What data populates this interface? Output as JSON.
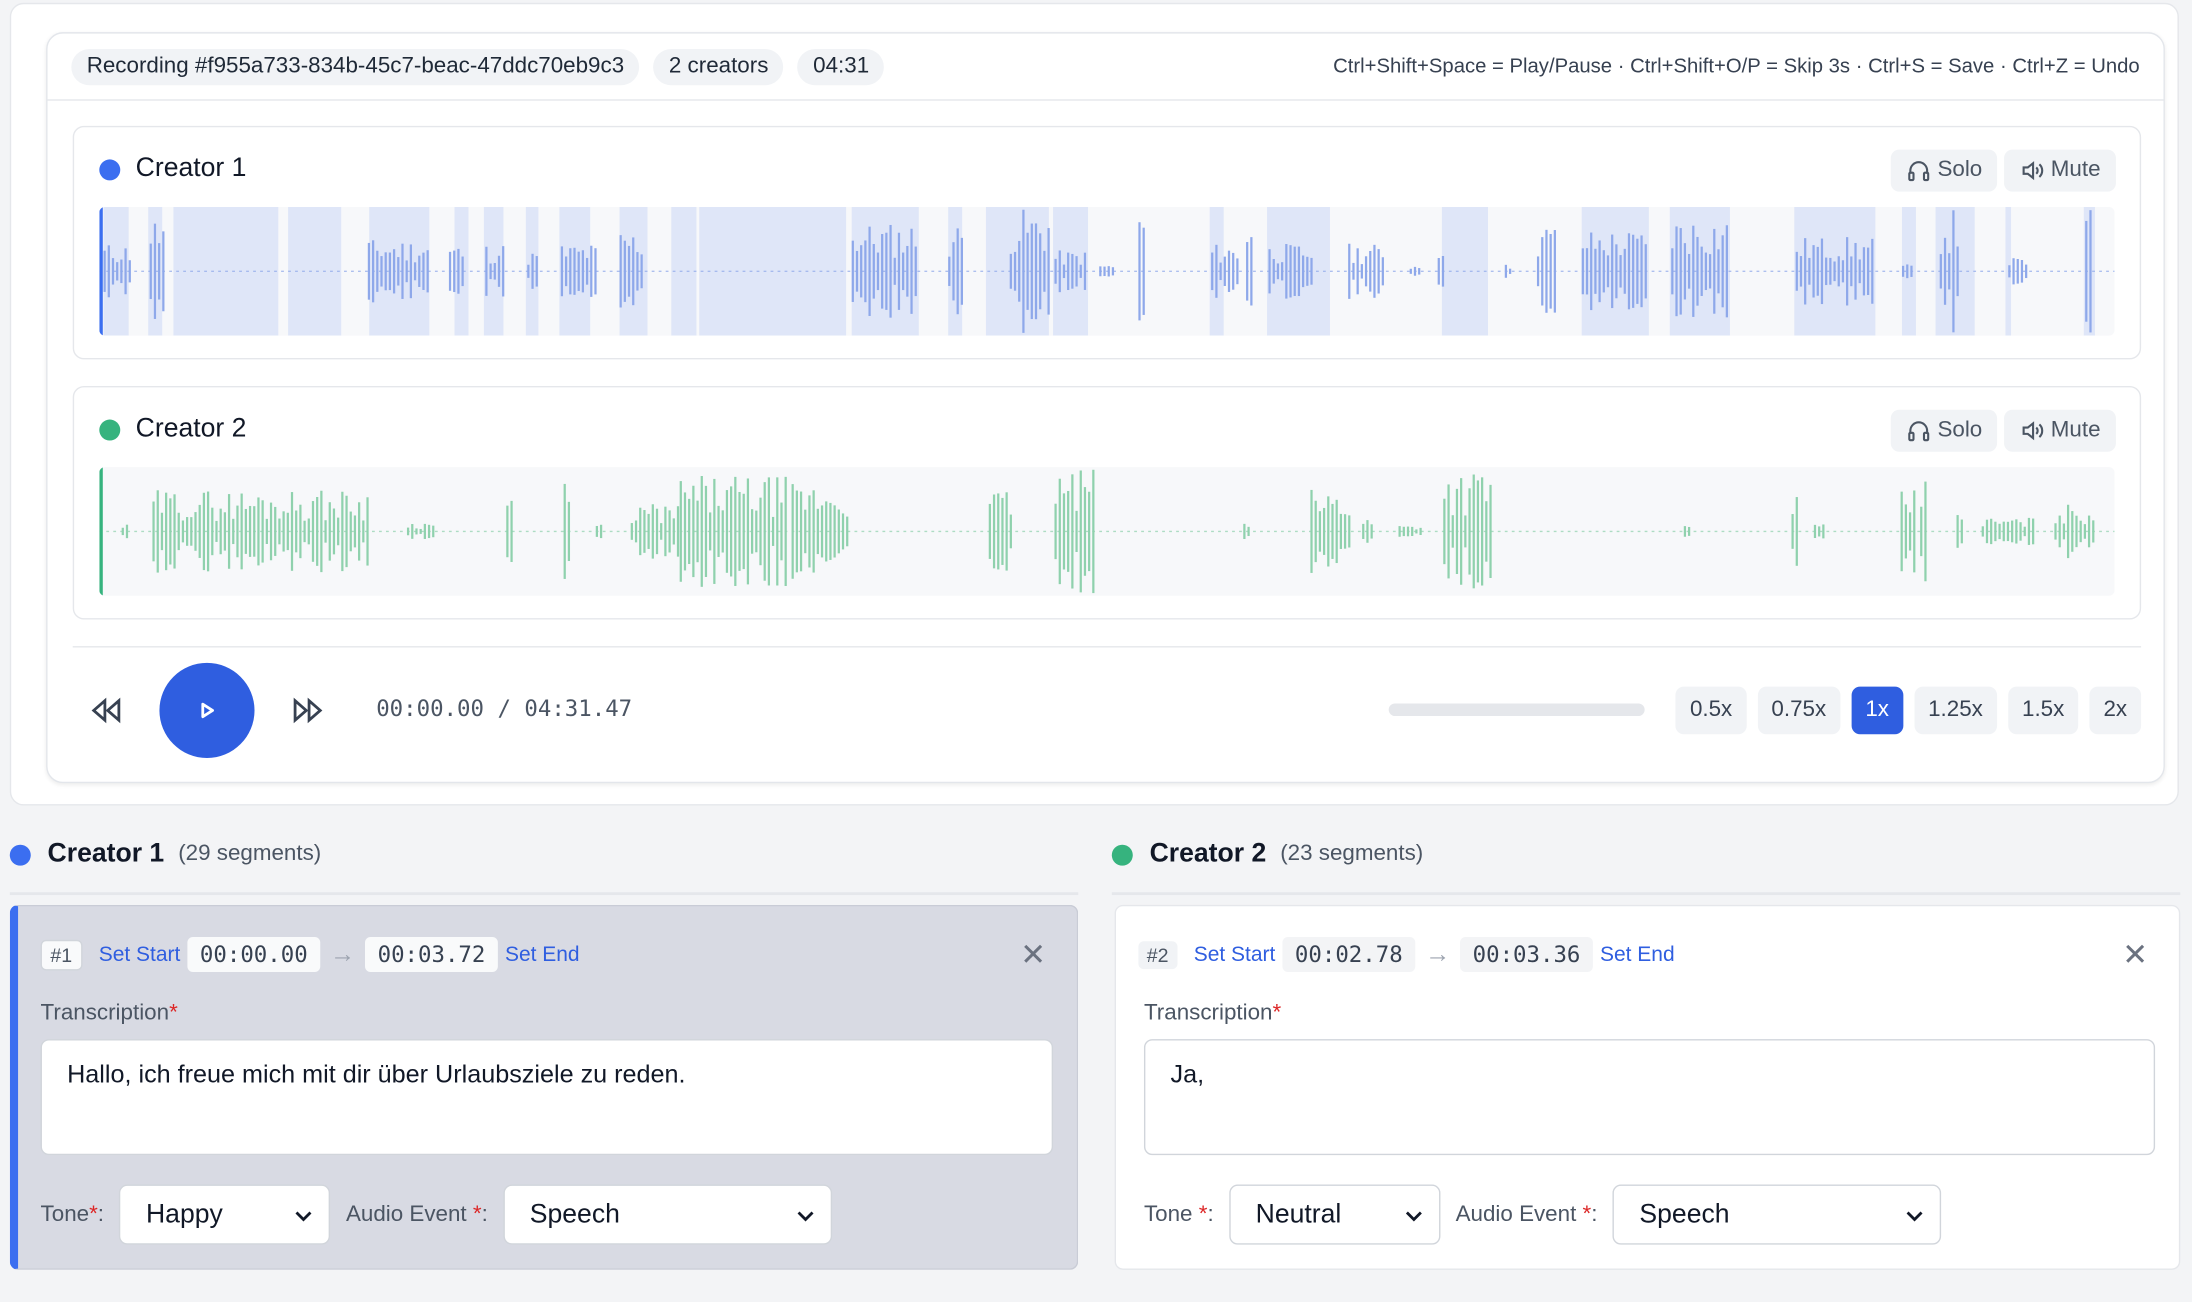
{
  "header": {
    "recording": "Recording #f955a733-834b-45c7-beac-47ddc70eb9c3",
    "creators": "2 creators",
    "duration": "04:31",
    "shortcuts": "Ctrl+Shift+Space = Play/Pause · Ctrl+Shift+O/P = Skip 3s · Ctrl+S = Save · Ctrl+Z = Undo"
  },
  "tracks": [
    {
      "name": "Creator 1",
      "color": "#3b6ef0",
      "wave_color": "#8ea8ea",
      "solo": "Solo",
      "mute": "Mute"
    },
    {
      "name": "Creator 2",
      "color": "#36b37e",
      "wave_color": "#8fd1ad",
      "solo": "Solo",
      "mute": "Mute"
    }
  ],
  "player": {
    "time": "00:00.00 / 04:31.47",
    "speeds": [
      "0.5x",
      "0.75x",
      "1x",
      "1.25x",
      "1.5x",
      "2x"
    ],
    "active_speed": "1x"
  },
  "columns": [
    {
      "title": "Creator 1",
      "count": "(29 segments)",
      "color": "#3b6ef0"
    },
    {
      "title": "Creator 2",
      "count": "(23 segments)",
      "color": "#36b37e"
    }
  ],
  "segments": [
    {
      "num": "#1",
      "set_start": "Set Start",
      "start": "00:00.00",
      "end": "00:03.72",
      "set_end": "Set End",
      "transcription_label": "Transcription",
      "text": "Hallo, ich freue mich mit dir über Urlaubsziele zu reden.",
      "tone_label": "Tone",
      "tone": "Happy",
      "event_label": "Audio Event",
      "event": "Speech"
    },
    {
      "num": "#2",
      "set_start": "Set Start",
      "start": "00:02.78",
      "end": "00:03.36",
      "set_end": "Set End",
      "transcription_label": "Transcription",
      "text": "Ja,",
      "tone_label": "Tone",
      "tone": "Neutral",
      "event_label": "Audio Event",
      "event": "Speech"
    }
  ]
}
